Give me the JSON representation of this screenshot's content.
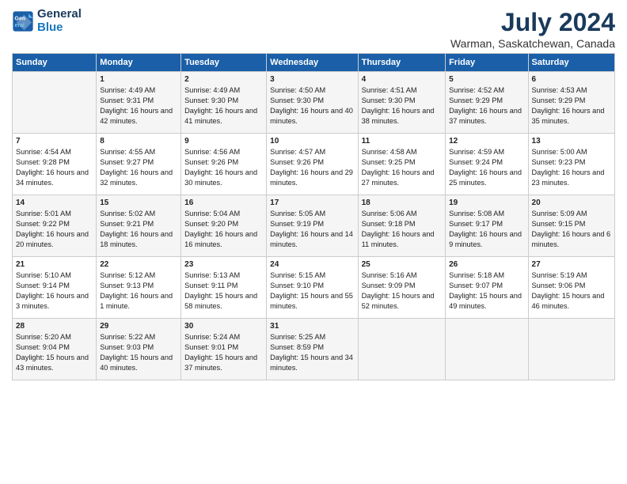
{
  "header": {
    "logo_line1": "General",
    "logo_line2": "Blue",
    "title": "July 2024",
    "subtitle": "Warman, Saskatchewan, Canada"
  },
  "days_of_week": [
    "Sunday",
    "Monday",
    "Tuesday",
    "Wednesday",
    "Thursday",
    "Friday",
    "Saturday"
  ],
  "weeks": [
    [
      {
        "day": "",
        "sunrise": "",
        "sunset": "",
        "daylight": ""
      },
      {
        "day": "1",
        "sunrise": "Sunrise: 4:49 AM",
        "sunset": "Sunset: 9:31 PM",
        "daylight": "Daylight: 16 hours and 42 minutes."
      },
      {
        "day": "2",
        "sunrise": "Sunrise: 4:49 AM",
        "sunset": "Sunset: 9:30 PM",
        "daylight": "Daylight: 16 hours and 41 minutes."
      },
      {
        "day": "3",
        "sunrise": "Sunrise: 4:50 AM",
        "sunset": "Sunset: 9:30 PM",
        "daylight": "Daylight: 16 hours and 40 minutes."
      },
      {
        "day": "4",
        "sunrise": "Sunrise: 4:51 AM",
        "sunset": "Sunset: 9:30 PM",
        "daylight": "Daylight: 16 hours and 38 minutes."
      },
      {
        "day": "5",
        "sunrise": "Sunrise: 4:52 AM",
        "sunset": "Sunset: 9:29 PM",
        "daylight": "Daylight: 16 hours and 37 minutes."
      },
      {
        "day": "6",
        "sunrise": "Sunrise: 4:53 AM",
        "sunset": "Sunset: 9:29 PM",
        "daylight": "Daylight: 16 hours and 35 minutes."
      }
    ],
    [
      {
        "day": "7",
        "sunrise": "Sunrise: 4:54 AM",
        "sunset": "Sunset: 9:28 PM",
        "daylight": "Daylight: 16 hours and 34 minutes."
      },
      {
        "day": "8",
        "sunrise": "Sunrise: 4:55 AM",
        "sunset": "Sunset: 9:27 PM",
        "daylight": "Daylight: 16 hours and 32 minutes."
      },
      {
        "day": "9",
        "sunrise": "Sunrise: 4:56 AM",
        "sunset": "Sunset: 9:26 PM",
        "daylight": "Daylight: 16 hours and 30 minutes."
      },
      {
        "day": "10",
        "sunrise": "Sunrise: 4:57 AM",
        "sunset": "Sunset: 9:26 PM",
        "daylight": "Daylight: 16 hours and 29 minutes."
      },
      {
        "day": "11",
        "sunrise": "Sunrise: 4:58 AM",
        "sunset": "Sunset: 9:25 PM",
        "daylight": "Daylight: 16 hours and 27 minutes."
      },
      {
        "day": "12",
        "sunrise": "Sunrise: 4:59 AM",
        "sunset": "Sunset: 9:24 PM",
        "daylight": "Daylight: 16 hours and 25 minutes."
      },
      {
        "day": "13",
        "sunrise": "Sunrise: 5:00 AM",
        "sunset": "Sunset: 9:23 PM",
        "daylight": "Daylight: 16 hours and 23 minutes."
      }
    ],
    [
      {
        "day": "14",
        "sunrise": "Sunrise: 5:01 AM",
        "sunset": "Sunset: 9:22 PM",
        "daylight": "Daylight: 16 hours and 20 minutes."
      },
      {
        "day": "15",
        "sunrise": "Sunrise: 5:02 AM",
        "sunset": "Sunset: 9:21 PM",
        "daylight": "Daylight: 16 hours and 18 minutes."
      },
      {
        "day": "16",
        "sunrise": "Sunrise: 5:04 AM",
        "sunset": "Sunset: 9:20 PM",
        "daylight": "Daylight: 16 hours and 16 minutes."
      },
      {
        "day": "17",
        "sunrise": "Sunrise: 5:05 AM",
        "sunset": "Sunset: 9:19 PM",
        "daylight": "Daylight: 16 hours and 14 minutes."
      },
      {
        "day": "18",
        "sunrise": "Sunrise: 5:06 AM",
        "sunset": "Sunset: 9:18 PM",
        "daylight": "Daylight: 16 hours and 11 minutes."
      },
      {
        "day": "19",
        "sunrise": "Sunrise: 5:08 AM",
        "sunset": "Sunset: 9:17 PM",
        "daylight": "Daylight: 16 hours and 9 minutes."
      },
      {
        "day": "20",
        "sunrise": "Sunrise: 5:09 AM",
        "sunset": "Sunset: 9:15 PM",
        "daylight": "Daylight: 16 hours and 6 minutes."
      }
    ],
    [
      {
        "day": "21",
        "sunrise": "Sunrise: 5:10 AM",
        "sunset": "Sunset: 9:14 PM",
        "daylight": "Daylight: 16 hours and 3 minutes."
      },
      {
        "day": "22",
        "sunrise": "Sunrise: 5:12 AM",
        "sunset": "Sunset: 9:13 PM",
        "daylight": "Daylight: 16 hours and 1 minute."
      },
      {
        "day": "23",
        "sunrise": "Sunrise: 5:13 AM",
        "sunset": "Sunset: 9:11 PM",
        "daylight": "Daylight: 15 hours and 58 minutes."
      },
      {
        "day": "24",
        "sunrise": "Sunrise: 5:15 AM",
        "sunset": "Sunset: 9:10 PM",
        "daylight": "Daylight: 15 hours and 55 minutes."
      },
      {
        "day": "25",
        "sunrise": "Sunrise: 5:16 AM",
        "sunset": "Sunset: 9:09 PM",
        "daylight": "Daylight: 15 hours and 52 minutes."
      },
      {
        "day": "26",
        "sunrise": "Sunrise: 5:18 AM",
        "sunset": "Sunset: 9:07 PM",
        "daylight": "Daylight: 15 hours and 49 minutes."
      },
      {
        "day": "27",
        "sunrise": "Sunrise: 5:19 AM",
        "sunset": "Sunset: 9:06 PM",
        "daylight": "Daylight: 15 hours and 46 minutes."
      }
    ],
    [
      {
        "day": "28",
        "sunrise": "Sunrise: 5:20 AM",
        "sunset": "Sunset: 9:04 PM",
        "daylight": "Daylight: 15 hours and 43 minutes."
      },
      {
        "day": "29",
        "sunrise": "Sunrise: 5:22 AM",
        "sunset": "Sunset: 9:03 PM",
        "daylight": "Daylight: 15 hours and 40 minutes."
      },
      {
        "day": "30",
        "sunrise": "Sunrise: 5:24 AM",
        "sunset": "Sunset: 9:01 PM",
        "daylight": "Daylight: 15 hours and 37 minutes."
      },
      {
        "day": "31",
        "sunrise": "Sunrise: 5:25 AM",
        "sunset": "Sunset: 8:59 PM",
        "daylight": "Daylight: 15 hours and 34 minutes."
      },
      {
        "day": "",
        "sunrise": "",
        "sunset": "",
        "daylight": ""
      },
      {
        "day": "",
        "sunrise": "",
        "sunset": "",
        "daylight": ""
      },
      {
        "day": "",
        "sunrise": "",
        "sunset": "",
        "daylight": ""
      }
    ]
  ]
}
